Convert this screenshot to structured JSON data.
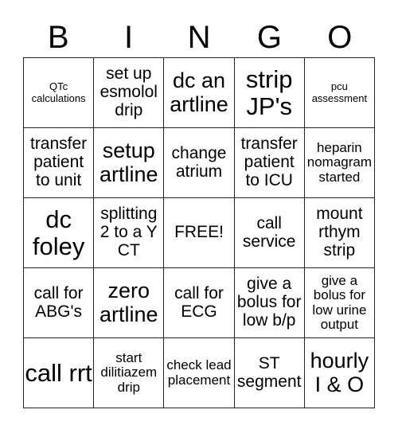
{
  "header": {
    "letters": [
      "B",
      "I",
      "N",
      "G",
      "O"
    ]
  },
  "card": {
    "cells": [
      {
        "text": "QTc calculations",
        "size": "xs"
      },
      {
        "text": "set up esmolol drip",
        "size": "md"
      },
      {
        "text": "dc an artline",
        "size": "lg"
      },
      {
        "text": "strip JP's",
        "size": "xl"
      },
      {
        "text": "pcu assessment",
        "size": "xs"
      },
      {
        "text": "transfer patient to unit",
        "size": "md"
      },
      {
        "text": "setup artline",
        "size": "lg"
      },
      {
        "text": "change atrium",
        "size": "md"
      },
      {
        "text": "transfer patient to ICU",
        "size": "md"
      },
      {
        "text": "heparin nomagram started",
        "size": "sm"
      },
      {
        "text": "dc foley",
        "size": "xl"
      },
      {
        "text": "splitting 2 to a Y CT",
        "size": "md"
      },
      {
        "text": "FREE!",
        "size": "md"
      },
      {
        "text": "call service",
        "size": "md"
      },
      {
        "text": "mount rthym strip",
        "size": "md"
      },
      {
        "text": "call for ABG's",
        "size": "md"
      },
      {
        "text": "zero artline",
        "size": "lg"
      },
      {
        "text": "call for ECG",
        "size": "md"
      },
      {
        "text": "give a bolus for low b/p",
        "size": "md"
      },
      {
        "text": "give a bolus for low urine output",
        "size": "sm"
      },
      {
        "text": "call rrt",
        "size": "xl"
      },
      {
        "text": "start dilitiazem drip",
        "size": "sm"
      },
      {
        "text": "check lead placement",
        "size": "sm"
      },
      {
        "text": "ST segment",
        "size": "md"
      },
      {
        "text": "hourly I & O",
        "size": "lg"
      }
    ]
  }
}
